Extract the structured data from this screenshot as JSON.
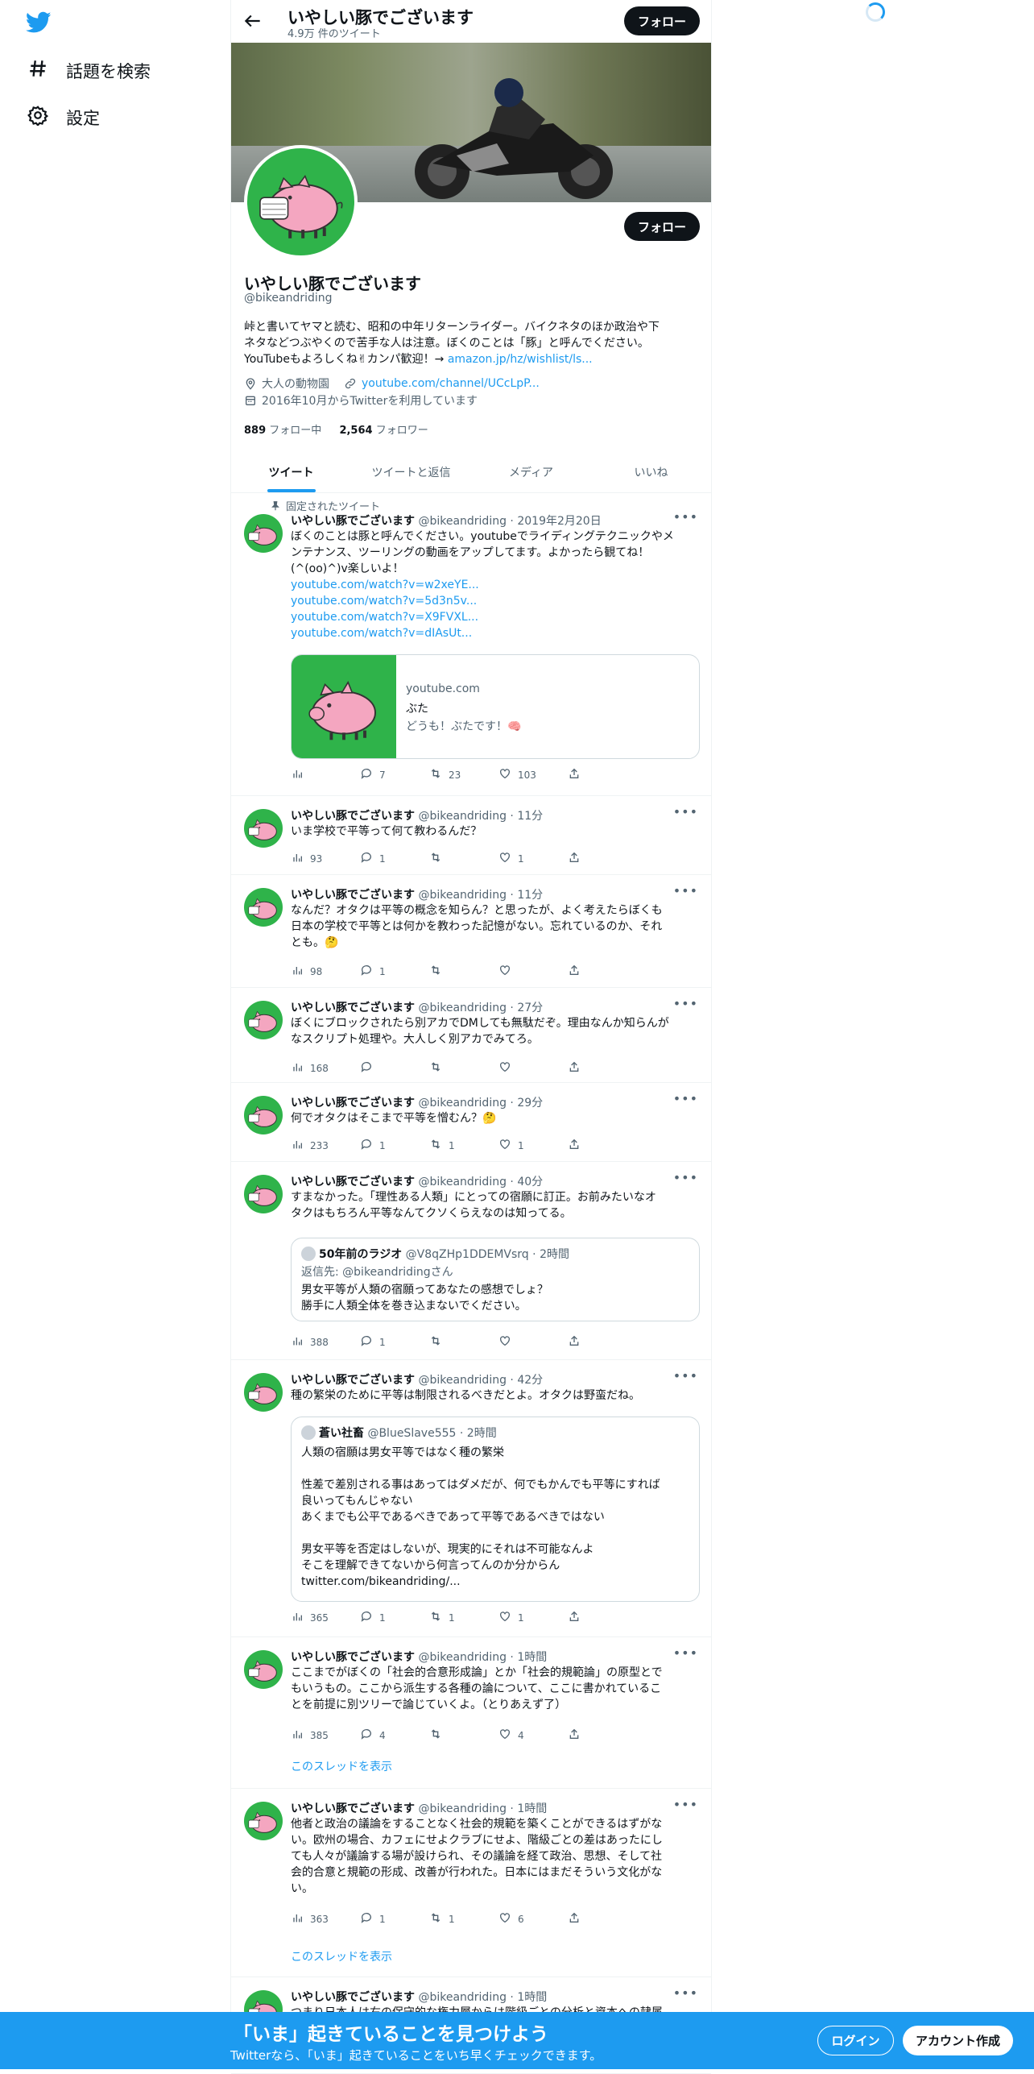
{
  "sidebar": {
    "items": [
      {
        "label": "話題を検索",
        "icon": "hashtag-icon"
      },
      {
        "label": "設定",
        "icon": "gear-icon"
      }
    ]
  },
  "header": {
    "title": "いやしい豚でございます",
    "tweet_count": "4.9万 件のツイート",
    "follow_label": "フォロー"
  },
  "profile": {
    "name": "いやしい豚でございます",
    "handle": "@bikeandriding",
    "follow_label": "フォロー",
    "bio_line1": "峠と書いてヤマと読む、昭和の中年リターンライダー。バイクネタのほか政治や下",
    "bio_line2": "ネタなどつぶやくので苦手な人は注意。ぼくのことは「豚」と呼んでください。",
    "bio_line3": "YouTubeもよろしくね✌カンパ歓迎！→ ",
    "bio_link": "amazon.jp/hz/wishlist/ls...",
    "location": "大人の動物園",
    "url": "youtube.com/channel/UCcLpP...",
    "joined": "2016年10月からTwitterを利用しています",
    "following_count": "889",
    "following_label": "フォロー中",
    "followers_count": "2,564",
    "followers_label": "フォロワー"
  },
  "tabs": [
    "ツイート",
    "ツイートと返信",
    "メディア",
    "いいね"
  ],
  "pinned_label": "固定されたツイート",
  "tweets": [
    {
      "name": "いやしい豚でございます",
      "handle": "@bikeandriding",
      "time": "2019年2月20日",
      "text": "ぼくのことは豚と呼んでください。youtubeでライディングテクニックやメ\nンテナンス、ツーリングの動画をアップしてます。よかったら観てね！\n(^(oo)^)v楽しいよ！",
      "links": [
        "youtube.com/watch?v=w2xeYE...",
        "youtube.com/watch?v=5d3n5v...",
        "youtube.com/watch?v=X9FVXL...",
        "youtube.com/watch?v=dIAsUt..."
      ],
      "card": {
        "domain": "youtube.com",
        "title": "ぶた",
        "desc": "どうも！ぶたです！🧠"
      },
      "views": "",
      "replies": "7",
      "retweets": "23",
      "likes": "103"
    },
    {
      "name": "いやしい豚でございます",
      "handle": "@bikeandriding",
      "time": "11分",
      "text": "いま学校で平等って何て教わるんだ？",
      "views": "93",
      "replies": "1",
      "retweets": "",
      "likes": "1"
    },
    {
      "name": "いやしい豚でございます",
      "handle": "@bikeandriding",
      "time": "11分",
      "text": "なんだ？オタクは平等の概念を知らん？と思ったが、よく考えたらぼくも\n日本の学校で平等とは何かを教わった記憶がない。忘れているのか、それ\nとも。🤔",
      "views": "98",
      "replies": "1",
      "retweets": "",
      "likes": ""
    },
    {
      "name": "いやしい豚でございます",
      "handle": "@bikeandriding",
      "time": "27分",
      "text": "ぼくにブロックされたら別アカでDMしても無駄だぞ。理由なんか知らんが\nなスクリプト処理や。大人しく別アカでみてろ。",
      "views": "168",
      "replies": "",
      "retweets": "",
      "likes": ""
    },
    {
      "name": "いやしい豚でございます",
      "handle": "@bikeandriding",
      "time": "29分",
      "text": "何でオタクはそこまで平等を憎むん？🤔",
      "views": "233",
      "replies": "1",
      "retweets": "1",
      "likes": "1"
    },
    {
      "name": "いやしい豚でございます",
      "handle": "@bikeandriding",
      "time": "40分",
      "text": "すまなかった。「理性ある人類」にとっての宿願に訂正。お前みたいなオ\nタクはもちろん平等なんてクソくらえなのは知ってる。",
      "quote": {
        "name": "50年前のラジオ",
        "handle": "@V8qZHp1DDEMVsrq",
        "time": "2時間",
        "reply_to": "返信先: @bikeandridingさん",
        "text": "男女平等が人類の宿願ってあなたの感想でしょ？\n勝手に人類全体を巻き込まないでください。"
      },
      "views": "388",
      "replies": "1",
      "retweets": "",
      "likes": ""
    },
    {
      "name": "いやしい豚でございます",
      "handle": "@bikeandriding",
      "time": "42分",
      "text": "種の繁栄のために平等は制限されるべきだとよ。オタクは野蛮だね。",
      "quote": {
        "name": "蒼い社畜",
        "handle": "@BlueSlave555",
        "time": "2時間",
        "reply_to": "",
        "text": "人類の宿願は男女平等ではなく種の繁栄\n\n性差で差別される事はあってはダメだが、何でもかんでも平等にすれば\n良いってもんじゃない\nあくまでも公平であるべきであって平等であるべきではない\n\n男女平等を否定はしないが、現実的にそれは不可能なんよ\nそこを理解できてないから何言ってんのか分からん\ntwitter.com/bikeandriding/..."
      },
      "views": "365",
      "replies": "1",
      "retweets": "1",
      "likes": "1"
    },
    {
      "name": "いやしい豚でございます",
      "handle": "@bikeandriding",
      "time": "1時間",
      "text": "ここまでがぼくの「社会的合意形成論」とか「社会的規範論」の原型とで\nもいうもの。ここから派生する各種の論について、ここに書かれているこ\nとを前提に別ツリーで論じていくよ。（とりあえず了）",
      "views": "385",
      "replies": "4",
      "retweets": "",
      "likes": "4",
      "show_thread": "このスレッドを表示"
    },
    {
      "name": "いやしい豚でございます",
      "handle": "@bikeandriding",
      "time": "1時間",
      "text": "他者と政治の議論をすることなく社会的規範を築くことができるはずがな\nい。欧州の場合、カフェにせよクラブにせよ、階級ごとの差はあったにし\nても人々が議論する場が設けられ、その議論を経て政治、思想、そして社\n会的合意と規範の形成、改善が行われた。日本にはまだそういう文化がな\nい。",
      "views": "363",
      "replies": "1",
      "retweets": "1",
      "likes": "6",
      "show_thread": "このスレッドを表示"
    },
    {
      "name": "いやしい豚でございます",
      "handle": "@bikeandriding",
      "time": "1時間",
      "text": "つまり日本人は右の保守的な権力層からは階級ごとの分析と資本への隷属",
      "views": "",
      "replies": "",
      "retweets": "",
      "likes": ""
    }
  ],
  "bottom_bar": {
    "title": "「いま」起きていることを見つけよう",
    "subtitle": "Twitterなら、「いま」起きていることをいち早くチェックできます。",
    "login_label": "ログイン",
    "signup_label": "アカウント作成"
  },
  "colors": {
    "accent": "#1d9bf0",
    "dark": "#0f1419",
    "avatar_green": "#2fb34a",
    "pig_pink": "#f4a6c0"
  }
}
